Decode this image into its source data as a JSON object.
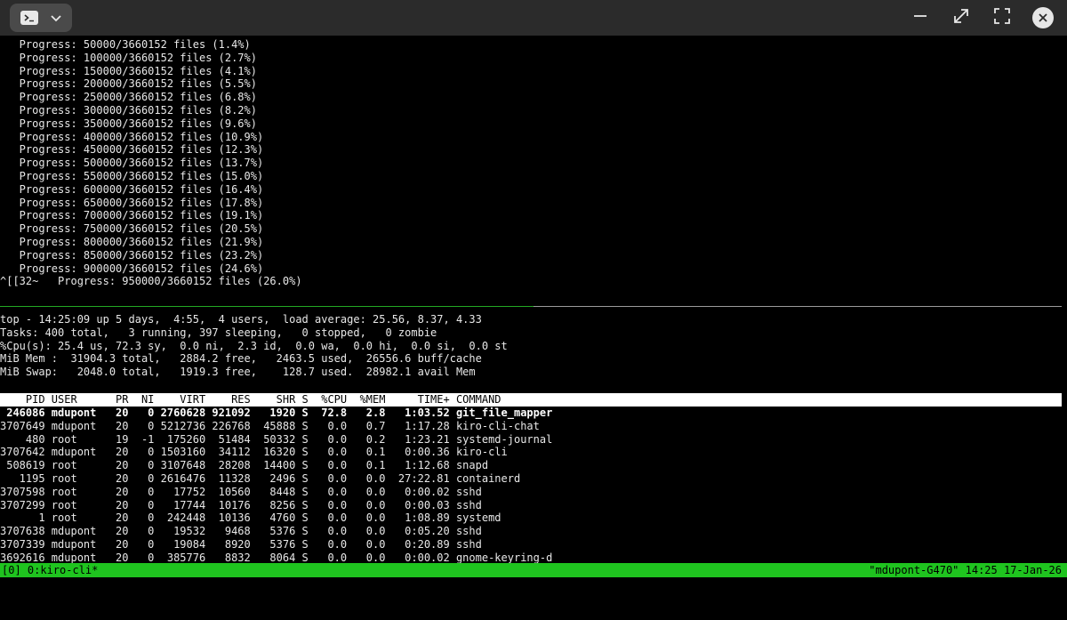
{
  "titlebar": {
    "icons": [
      "terminal-icon",
      "chevron-down-icon",
      "minimize-icon",
      "maximize-icon",
      "fullscreen-icon",
      "close-icon"
    ]
  },
  "terminal": {
    "progress_lines": [
      "   Progress: 50000/3660152 files (1.4%)",
      "   Progress: 100000/3660152 files (2.7%)",
      "   Progress: 150000/3660152 files (4.1%)",
      "   Progress: 200000/3660152 files (5.5%)",
      "   Progress: 250000/3660152 files (6.8%)",
      "   Progress: 300000/3660152 files (8.2%)",
      "   Progress: 350000/3660152 files (9.6%)",
      "   Progress: 400000/3660152 files (10.9%)",
      "   Progress: 450000/3660152 files (12.3%)",
      "   Progress: 500000/3660152 files (13.7%)",
      "   Progress: 550000/3660152 files (15.0%)",
      "   Progress: 600000/3660152 files (16.4%)",
      "   Progress: 650000/3660152 files (17.8%)",
      "   Progress: 700000/3660152 files (19.1%)",
      "   Progress: 750000/3660152 files (20.5%)",
      "   Progress: 800000/3660152 files (21.9%)",
      "   Progress: 850000/3660152 files (23.2%)",
      "   Progress: 900000/3660152 files (24.6%)",
      "^[[32~   Progress: 950000/3660152 files (26.0%)"
    ]
  },
  "top": {
    "summary": [
      "top - 14:25:09 up 5 days,  4:55,  4 users,  load average: 25.56, 8.37, 4.33",
      "Tasks: 400 total,   3 running, 397 sleeping,   0 stopped,   0 zombie",
      "%Cpu(s): 25.4 us, 72.3 sy,  0.0 ni,  2.3 id,  0.0 wa,  0.0 hi,  0.0 si,  0.0 st",
      "MiB Mem :  31904.3 total,   2884.2 free,   2463.5 used,  26556.6 buff/cache",
      "MiB Swap:   2048.0 total,   1919.3 free,    128.7 used.  28982.1 avail Mem"
    ],
    "columns": "    PID USER      PR  NI    VIRT    RES    SHR S  %CPU  %MEM     TIME+ COMMAND",
    "processes": [
      " 246086 mdupont   20   0 2760628 921092   1920 S  72.8   2.8   1:03.52 git_file_mapper",
      "3707649 mdupont   20   0 5212736 226768  45888 S   0.0   0.7   1:17.28 kiro-cli-chat",
      "    480 root      19  -1  175260  51484  50332 S   0.0   0.2   1:23.21 systemd-journal",
      "3707642 mdupont   20   0 1503160  34112  16320 S   0.0   0.1   0:00.36 kiro-cli",
      " 508619 root      20   0 3107648  28208  14400 S   0.0   0.1   1:12.68 snapd",
      "   1195 root      20   0 2616476  11328   2496 S   0.0   0.0  27:22.81 containerd",
      "3707598 root      20   0   17752  10560   8448 S   0.0   0.0   0:00.02 sshd",
      "3707299 root      20   0   17744  10176   8256 S   0.0   0.0   0:00.03 sshd",
      "      1 root      20   0  242448  10136   4760 S   0.0   0.0   1:08.89 systemd",
      "3707638 mdupont   20   0   19532   9468   5376 S   0.0   0.0   0:05.20 sshd",
      "3707339 mdupont   20   0   19084   8920   5376 S   0.0   0.0   0:20.89 sshd",
      "3692616 mdupont   20   0  385776   8832   8064 S   0.0   0.0   0:00.02 gnome-keyring-d"
    ]
  },
  "tmux": {
    "window": "[0] 0:kiro-cli*",
    "host_time": "\"mdupont-G470\" 14:25 17-Jan-26"
  },
  "colors": {
    "titlebar_bg": "#2b2b2b",
    "terminal_bg": "#000000",
    "status_bg": "#1fc41f",
    "pane_border_active": "#23a823"
  }
}
